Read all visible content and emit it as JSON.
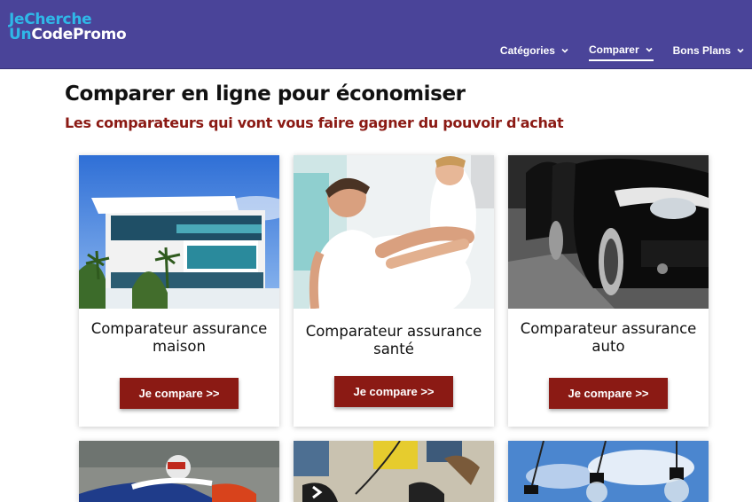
{
  "header": {
    "logo_line1": "JeCherche",
    "logo_line2a": "Un",
    "logo_line2b": "CodePromo",
    "nav": [
      {
        "label": "Catégories"
      },
      {
        "label": "Comparer"
      },
      {
        "label": "Bons Plans"
      }
    ]
  },
  "main": {
    "title": "Comparer en ligne pour économiser",
    "subtitle": "Les comparateurs qui vont vous faire gagner du pouvoir d'achat",
    "cards": [
      {
        "line1": "Comparateur assurance",
        "line2": "maison",
        "button": "Je compare >>"
      },
      {
        "line1": "Comparateur assurance",
        "line2": "santé",
        "button": "Je compare >>"
      },
      {
        "line1": "Comparateur assurance",
        "line2": "auto",
        "button": "Je compare >>"
      }
    ]
  },
  "colors": {
    "header_bg": "#4a4499",
    "accent": "#8b1a14",
    "logo_blue": "#2fb8e8"
  }
}
